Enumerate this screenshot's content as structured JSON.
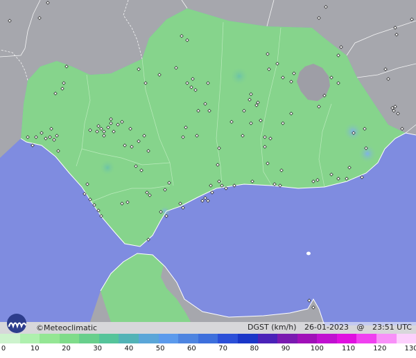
{
  "branding": {
    "copyright_symbol": "©",
    "name": "Meteoclimatic"
  },
  "map_info": {
    "variable": "DGST (km/h)",
    "date": "26-01-2023",
    "separator": "@",
    "time": "23:51 UTC"
  },
  "legend": {
    "labels": [
      "0",
      "10",
      "20",
      "30",
      "40",
      "50",
      "60",
      "70",
      "80",
      "90",
      "100",
      "110",
      "120",
      "130"
    ],
    "colors": [
      "#cdf3cd",
      "#aef0ae",
      "#94e694",
      "#7fdc8a",
      "#68cf8c",
      "#55c49a",
      "#52b3b6",
      "#5aa6d8",
      "#5b9aec",
      "#4d84e0",
      "#3d6fdc",
      "#2b4fd8",
      "#1a36c8",
      "#4a22b8",
      "#7a1ab0",
      "#a010b8",
      "#c010d0",
      "#e010e0",
      "#f040f0",
      "#f890f8",
      "#fcd0fc"
    ]
  },
  "colors": {
    "sea": "#7f8ce0",
    "land_other": "#a6a7ad",
    "land_region": "#86d48c"
  }
}
